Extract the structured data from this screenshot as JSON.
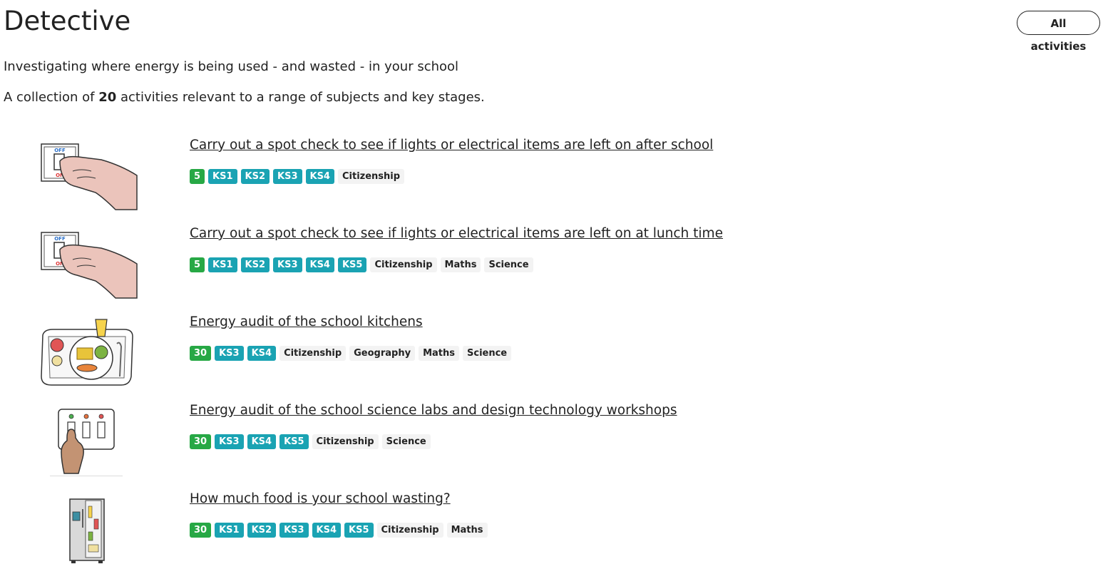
{
  "header": {
    "title": "Detective",
    "all_activities_label": "All activities"
  },
  "intro": {
    "description": "Investigating where energy is being used - and wasted - in your school",
    "count_prefix": "A collection of ",
    "count_value": "20",
    "count_suffix": " activities relevant to a range of subjects and key stages."
  },
  "activities": [
    {
      "title": "Carry out a spot check to see if lights or electrical items are left on after school",
      "image_icon": "light-switch-hand-icon",
      "tags": [
        {
          "label": "5",
          "kind": "time"
        },
        {
          "label": "KS1",
          "kind": "ks"
        },
        {
          "label": "KS2",
          "kind": "ks"
        },
        {
          "label": "KS3",
          "kind": "ks"
        },
        {
          "label": "KS4",
          "kind": "ks"
        },
        {
          "label": "Citizenship",
          "kind": "subj"
        }
      ]
    },
    {
      "title": "Carry out a spot check to see if lights or electrical items are left on at lunch time",
      "image_icon": "light-switch-hand-icon",
      "tags": [
        {
          "label": "5",
          "kind": "time"
        },
        {
          "label": "KS1",
          "kind": "ks"
        },
        {
          "label": "KS2",
          "kind": "ks"
        },
        {
          "label": "KS3",
          "kind": "ks"
        },
        {
          "label": "KS4",
          "kind": "ks"
        },
        {
          "label": "KS5",
          "kind": "ks"
        },
        {
          "label": "Citizenship",
          "kind": "subj"
        },
        {
          "label": "Maths",
          "kind": "subj"
        },
        {
          "label": "Science",
          "kind": "subj"
        }
      ]
    },
    {
      "title": "Energy audit of the school kitchens",
      "image_icon": "lunch-tray-icon",
      "tags": [
        {
          "label": "30",
          "kind": "time"
        },
        {
          "label": "KS3",
          "kind": "ks"
        },
        {
          "label": "KS4",
          "kind": "ks"
        },
        {
          "label": "Citizenship",
          "kind": "subj"
        },
        {
          "label": "Geography",
          "kind": "subj"
        },
        {
          "label": "Maths",
          "kind": "subj"
        },
        {
          "label": "Science",
          "kind": "subj"
        }
      ]
    },
    {
      "title": "Energy audit of the school science labs and design technology workshops",
      "image_icon": "switch-panel-hand-icon",
      "tags": [
        {
          "label": "30",
          "kind": "time"
        },
        {
          "label": "KS3",
          "kind": "ks"
        },
        {
          "label": "KS4",
          "kind": "ks"
        },
        {
          "label": "KS5",
          "kind": "ks"
        },
        {
          "label": "Citizenship",
          "kind": "subj"
        },
        {
          "label": "Science",
          "kind": "subj"
        }
      ]
    },
    {
      "title": "How much food is your school wasting?",
      "image_icon": "fridge-icon",
      "tags": [
        {
          "label": "30",
          "kind": "time"
        },
        {
          "label": "KS1",
          "kind": "ks"
        },
        {
          "label": "KS2",
          "kind": "ks"
        },
        {
          "label": "KS3",
          "kind": "ks"
        },
        {
          "label": "KS4",
          "kind": "ks"
        },
        {
          "label": "KS5",
          "kind": "ks"
        },
        {
          "label": "Citizenship",
          "kind": "subj"
        },
        {
          "label": "Maths",
          "kind": "subj"
        }
      ]
    }
  ],
  "colors": {
    "time_badge": "#27a845",
    "key_stage_badge": "#1aa3b3",
    "subject_badge": "#f3f3f3",
    "text": "#222222"
  }
}
